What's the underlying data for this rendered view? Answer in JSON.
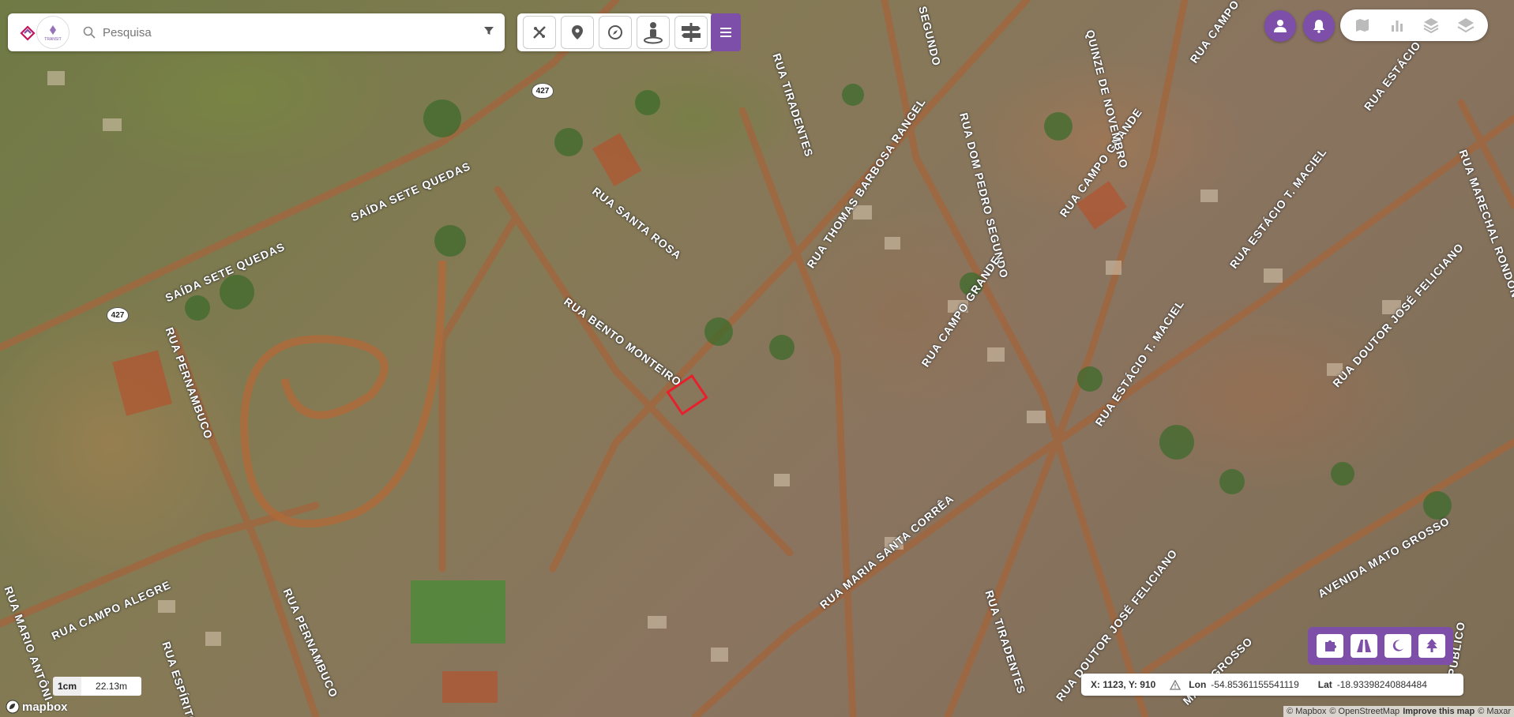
{
  "search": {
    "placeholder": "Pesquisa"
  },
  "logo": {
    "text": "TRANSIT"
  },
  "map": {
    "streets": [
      "SAÍDA SETE QUEDAS",
      "SAÍDA SETE QUEDAS",
      "RUA SANTA ROSA",
      "RUA BENTO MONTEIRO",
      "RUA PERNAMBUCO",
      "RUA PERNAMBUCO",
      "RUA CAMPO ALEGRE",
      "RUA ESPÍRITO S",
      "RUA MARIO ANTÔNI",
      "RUA TIRADENTES",
      "RUA TIRADENTES",
      "RUA THOMAS BARBOSA RANGEL",
      "RUA DOM PEDRO SEGUNDO",
      "SEGUNDO",
      "RUA CAMPO GRANDE",
      "RUA CAMPO GRANDE",
      "RUA CAMPO G",
      "QUINZE DE NOVEMBRO",
      "RUA ESTÁCIO T. MACIEL",
      "RUA ESTÁCIO T. MACIEL",
      "RUA ESTÁCIO",
      "RUA MARECHAL RONDON",
      "RUA DOUTOR JOSÉ FELICIANO",
      "RUA DOUTOR JOSÉ FELICIANO",
      "RUA MARIA SANTA CORRÊA",
      "AVENIDA MATO GROSSO",
      "MATO GROSSO",
      "PÚBLICO"
    ],
    "shields": [
      "427",
      "427"
    ]
  },
  "coords": {
    "xy": "X: 1123, Y: 910",
    "lon_label": "Lon",
    "lon_value": "-54.85361155541119",
    "lat_label": "Lat",
    "lat_value": "-18.93398240884484"
  },
  "scale": {
    "unit": "1cm",
    "distance": "22.13m"
  },
  "attribution": {
    "mapbox": "© Mapbox",
    "osm": "© OpenStreetMap",
    "improve": "Improve this map",
    "maxar": "© Maxar"
  },
  "brand": {
    "mapbox_logo": "mapbox"
  },
  "colors": {
    "accent": "#7d4fa8",
    "highlight": "#e8202b"
  }
}
